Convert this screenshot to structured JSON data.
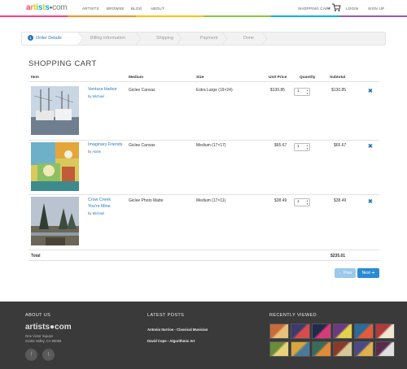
{
  "header": {
    "logo": {
      "a": "a",
      "r": "r",
      "t": "t",
      "i": "i",
      "s": "s",
      "t2": "t",
      "s2": "s",
      "dot": "●",
      "com": "com"
    },
    "nav": [
      "ARTISTS",
      "BROWSE",
      "BLOG",
      "ABOUT"
    ],
    "shopping_cart": "SHOPPING CART",
    "caret": "▾",
    "login": "LOGIN",
    "signup": "SIGN UP",
    "rainbow_colors": [
      "#ff3c7e",
      "#f7941d",
      "#ffc000",
      "#8cc63f",
      "#00aeef",
      "#9b59b6"
    ]
  },
  "steps": {
    "active_number": "1",
    "items": [
      "Order Details",
      "Billing Information",
      "Shipping",
      "Payment",
      "Done"
    ]
  },
  "title": "SHOPPING CART",
  "table": {
    "headers": {
      "item": "Item",
      "medium": "Medium",
      "size": "Size",
      "unit_price": "Unit Price",
      "quantity": "Quantity",
      "subtotal": "Subtotal"
    },
    "rows": [
      {
        "title": "Ventura Harbor",
        "by": "by",
        "artist": "Michael",
        "medium": "Giclee Canvas",
        "size": "Extra Large (19×24)",
        "unit_price": "$130.85",
        "quantity": "1",
        "subtotal": "$130.85"
      },
      {
        "title": "Imaginary Friends",
        "by": "by",
        "artist": "Adele",
        "medium": "Giclee Canvas",
        "size": "Medium (17×17)",
        "unit_price": "$65.67",
        "quantity": "1",
        "subtotal": "$65.67"
      },
      {
        "title": "Crow Creek",
        "title2": "You're Mine",
        "by": "by",
        "artist": "Michael",
        "medium": "Giclee Photo Matte",
        "size": "Medium (17×11)",
        "unit_price": "$38.49",
        "quantity": "1",
        "subtotal": "$38.49"
      }
    ],
    "total_label": "Total",
    "total_value": "$235.01"
  },
  "buttons": {
    "prev": "Prev",
    "next": "Next",
    "prev_arrow": "←",
    "next_arrow": "➜"
  },
  "footer": {
    "about_title": "ABOUT US",
    "logo": "artists●com",
    "address1": "One Victor Square",
    "address2": "Scotts Valley, CA 95066",
    "facebook": "f",
    "twitter": "t",
    "latest_title": "LATEST POSTS",
    "posts": [
      "Antonio Iturrios - Classical Musician",
      "David Cope - Algorithmic Art"
    ],
    "recent_title": "RECENTLY VIEWED"
  }
}
